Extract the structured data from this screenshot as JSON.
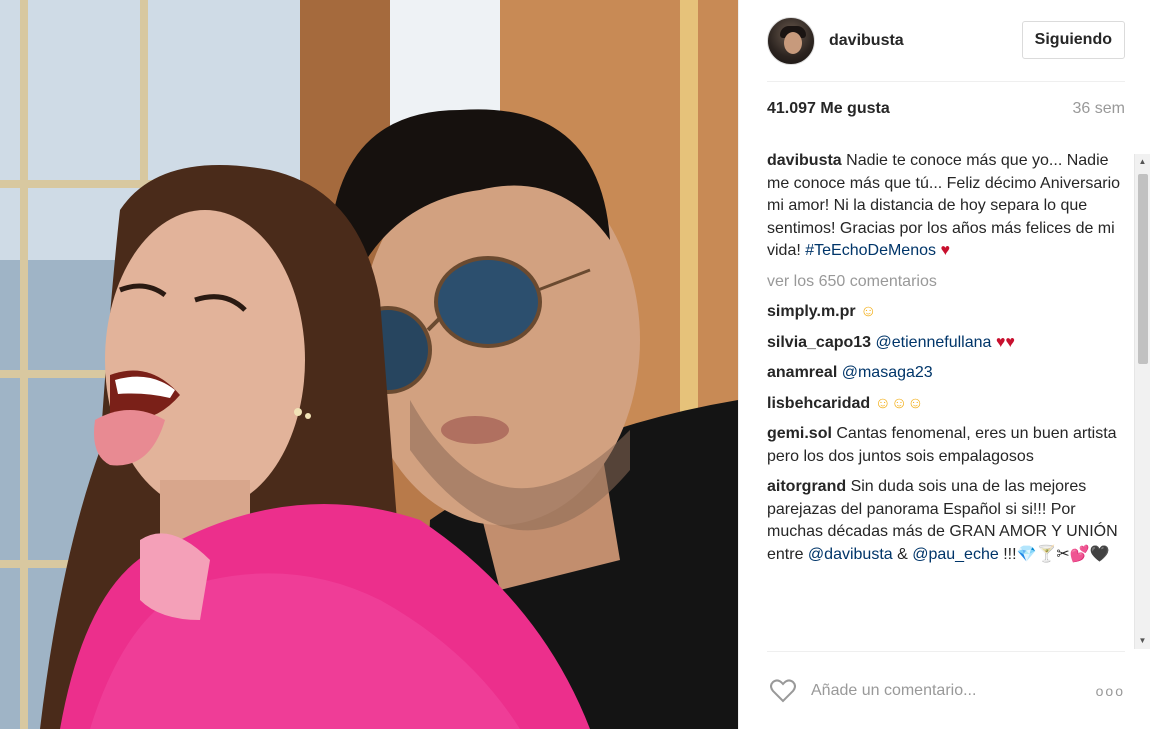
{
  "post": {
    "username": "davibusta",
    "follow_label": "Siguiendo",
    "likes": "41.097 Me gusta",
    "time_ago": "36 sem"
  },
  "caption": {
    "user": "davibusta",
    "text": "Nadie te conoce más que yo... Nadie me conoce más que tú... Feliz décimo Aniversario mi amor! Ni la distancia de hoy separa lo que sentimos! Gracias por los años más felices de mi vida! ",
    "hashtag": "#TeEchoDeMenos",
    "emoji": "♥"
  },
  "view_comments": "ver los 650 comentarios",
  "comments": [
    {
      "user": "simply.m.pr",
      "text": "",
      "mention": "",
      "emoji": "☺"
    },
    {
      "user": "silvia_capo13",
      "text": "",
      "mention": "@etiennefullana",
      "emoji": "♥♥"
    },
    {
      "user": "anamreal",
      "text": "",
      "mention": "@masaga23",
      "emoji": ""
    },
    {
      "user": "lisbehcaridad",
      "text": "",
      "mention": "",
      "emoji": "☺☺☺"
    },
    {
      "user": "gemi.sol",
      "text": "Cantas fenomenal, eres un buen artista pero los dos juntos sois empalagosos",
      "mention": "",
      "emoji": ""
    },
    {
      "user": "aitorgrand",
      "text": "Sin duda sois una de las mejores parejazas del panorama Español si si!!! Por muchas décadas más de GRAN AMOR Y UNIÓN entre ",
      "mention": "@davibusta",
      "joiner": " & ",
      "mention2": "@pau_eche",
      "tail": " !!!💎🍸✂💕🖤"
    }
  ],
  "footer": {
    "placeholder": "Añade un comentario...",
    "more": "ooo"
  },
  "colors": {
    "link": "#003569",
    "muted": "#999999",
    "heart": "#c8102e"
  }
}
